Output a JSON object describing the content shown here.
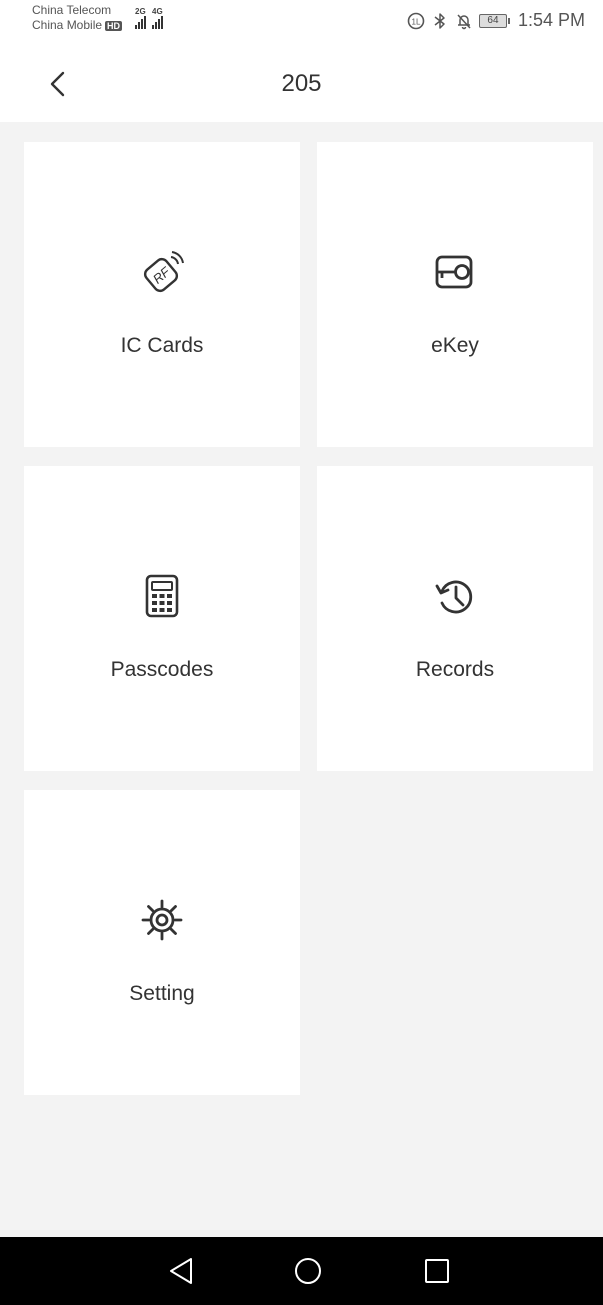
{
  "status_bar": {
    "carrier_1": "China Telecom",
    "carrier_2": "China Mobile",
    "hd_badge": "HD",
    "signal_1_network": "2G",
    "signal_2_network": "4G",
    "battery_level": "64",
    "time": "1:54 PM"
  },
  "header": {
    "title": "205",
    "back_icon": "chevron-left-icon"
  },
  "tiles": [
    {
      "label": "IC Cards",
      "icon": "rf-card-icon"
    },
    {
      "label": "eKey",
      "icon": "key-icon"
    },
    {
      "label": "Passcodes",
      "icon": "keypad-icon"
    },
    {
      "label": "Records",
      "icon": "history-icon"
    },
    {
      "label": "Setting",
      "icon": "gear-icon"
    }
  ],
  "nav_bar": {
    "back": "triangle-back-icon",
    "home": "circle-home-icon",
    "recents": "square-recents-icon"
  }
}
